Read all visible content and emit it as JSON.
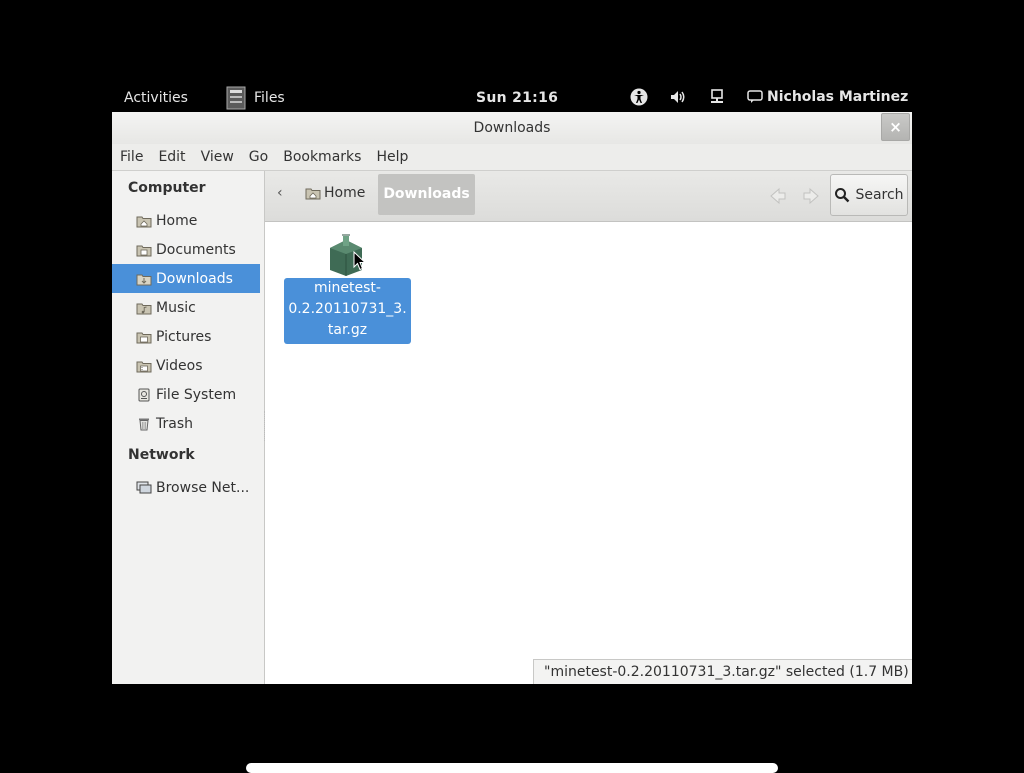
{
  "topbar": {
    "activities": "Activities",
    "app_name": "Files",
    "clock": "Sun 21:16",
    "user": "Nicholas Martinez",
    "icons": [
      "accessibility-icon",
      "volume-icon",
      "network-icon",
      "chat-status-icon"
    ]
  },
  "window": {
    "title": "Downloads",
    "close": "×"
  },
  "menubar": {
    "items": [
      "File",
      "Edit",
      "View",
      "Go",
      "Bookmarks",
      "Help"
    ]
  },
  "sidebar": {
    "computer_heading": "Computer",
    "items": [
      {
        "label": "Home",
        "icon": "home-folder-icon"
      },
      {
        "label": "Documents",
        "icon": "folder-icon"
      },
      {
        "label": "Downloads",
        "icon": "folder-icon",
        "selected": true
      },
      {
        "label": "Music",
        "icon": "folder-icon"
      },
      {
        "label": "Pictures",
        "icon": "folder-icon"
      },
      {
        "label": "Videos",
        "icon": "folder-icon"
      },
      {
        "label": "File System",
        "icon": "drive-icon"
      },
      {
        "label": "Trash",
        "icon": "trash-icon"
      }
    ],
    "network_heading": "Network",
    "network_items": [
      {
        "label": "Browse Net...",
        "icon": "network-browse-icon"
      }
    ]
  },
  "toolbar": {
    "back": "‹",
    "crumb_home": "Home",
    "crumb_current": "Downloads",
    "search": "Search"
  },
  "content": {
    "file": {
      "name_line1": "minetest-",
      "name_line2": "0.2.20110731_3.",
      "name_line3": "tar.gz",
      "icon": "archive-package-icon"
    }
  },
  "statusbar": {
    "text": "\"minetest-0.2.20110731_3.tar.gz\" selected (1.7 MB)"
  },
  "colors": {
    "selection": "#4a90d9",
    "background": "#000000"
  }
}
